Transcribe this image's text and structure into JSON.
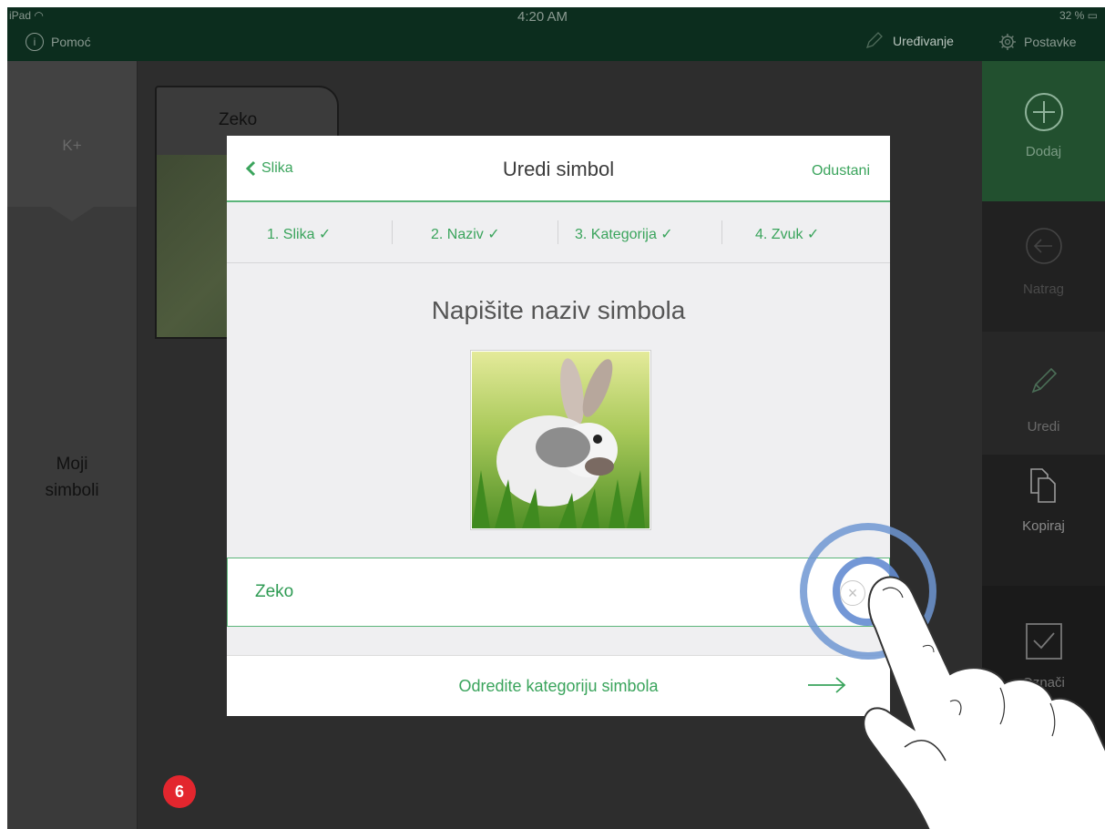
{
  "status_bar": {
    "device": "iPad",
    "time": "4:20 AM",
    "battery": "32 %",
    "help_label": "Pomoć",
    "help_icon": "info-icon",
    "edit_label": "Uređivanje",
    "edit_icon": "pencil-icon",
    "settings_label": "Postavke",
    "settings_icon": "gear-icon"
  },
  "sidebar": {
    "top_item": "K+",
    "category_line1": "Moji",
    "category_line2": "simboli"
  },
  "background_card": {
    "title": "Zeko"
  },
  "page_badge": "6",
  "toolbar": {
    "add": "Dodaj",
    "back": "Natrag",
    "edit": "Uredi",
    "copy": "Kopiraj",
    "mark": "Označi"
  },
  "modal": {
    "back_label": "Slika",
    "title": "Uredi simbol",
    "cancel_label": "Odustani",
    "steps": [
      {
        "label": "1. Slika",
        "check": "✓"
      },
      {
        "label": "2. Naziv",
        "check": "✓"
      },
      {
        "label": "3. Kategorija",
        "check": "✓"
      },
      {
        "label": "4. Zvuk",
        "check": "✓"
      }
    ],
    "heading": "Napišite naziv simbola",
    "name_value": "Zeko",
    "clear_symbol": "×",
    "next_label": "Odredite kategoriju simbola"
  },
  "colors": {
    "accent_green": "#3aa45c",
    "status_bar_bg": "#0c2d1e",
    "add_button_bg": "#22502f",
    "badge_red": "#e3262e",
    "touch_ring_blue": "#6e96d2"
  }
}
